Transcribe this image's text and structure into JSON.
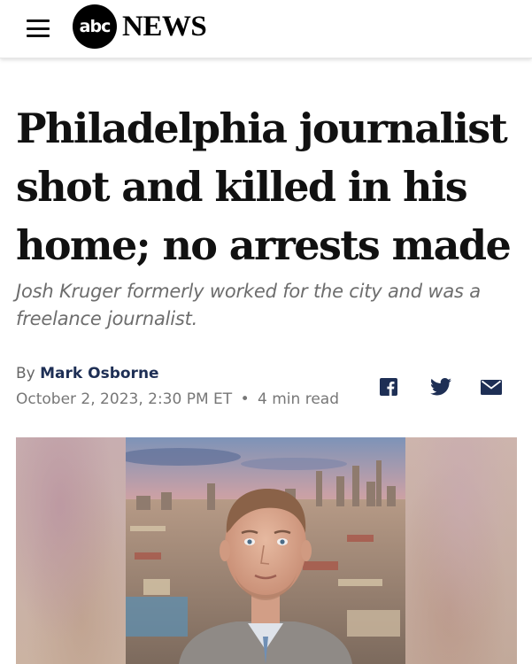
{
  "header": {
    "logo_abc": "abc",
    "logo_news": "NEWS",
    "menu_icon": "hamburger-menu-icon"
  },
  "article": {
    "headline": "Philadelphia journalist shot and killed in his home; no arrests made",
    "subheadline": "Josh Kruger formerly worked for the city and was a freelance journalist.",
    "byline_prefix": "By",
    "author": "Mark Osborne",
    "date": "October 2, 2023, 2:30 PM ET",
    "separator": "•",
    "read_time": "4 min read"
  },
  "share": {
    "icons": [
      "facebook-icon",
      "twitter-icon",
      "email-icon"
    ],
    "color": "#1e2f55"
  },
  "hero_image": {
    "subject": "portrait-photo"
  }
}
